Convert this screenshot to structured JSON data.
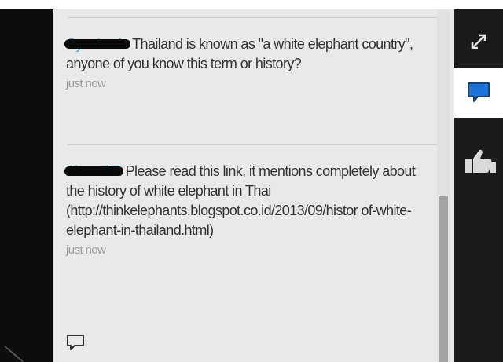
{
  "comments": [
    {
      "author": "Cyanian In",
      "text": "Thailand is known as \"a white elephant country\", anyone of you know this term or history?",
      "time": "just now"
    },
    {
      "author": "Ahmad F.",
      "text": "Please read this link, it mentions completely about the history of white elephant in Thai (http://thinkelephants.blogspot.co.id/2013/09/histor of-white-elephant-in-thailand.html)",
      "time": "just now"
    }
  ],
  "icons": {
    "compose": "comment-compose-icon",
    "expand": "expand-icon",
    "chat": "chat-bubble-icon",
    "like": "thumbs-up-icon"
  },
  "colors": {
    "accent": "#1a74d9",
    "author": "#3bb3c3",
    "panel": "#e9e9e9"
  }
}
